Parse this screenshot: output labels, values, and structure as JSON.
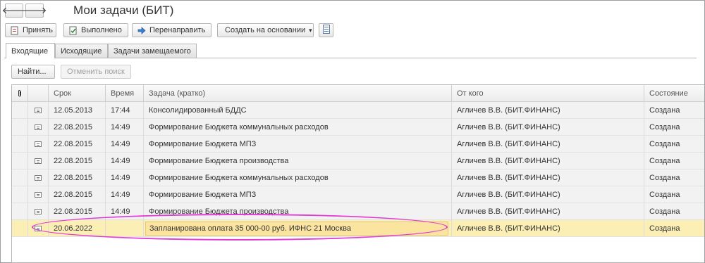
{
  "window": {
    "title": "Мои задачи (БИТ)"
  },
  "nav": {
    "back_label": "🡐",
    "forward_label": "🡒"
  },
  "toolbar": {
    "accept_label": "Принять",
    "done_label": "Выполнено",
    "redirect_label": "Перенаправить",
    "create_based_label": "Создать на основании",
    "dropdown_arrow": "▾"
  },
  "tabs": [
    {
      "label": "Входящие"
    },
    {
      "label": "Исходящие"
    },
    {
      "label": "Задачи замещаемого"
    }
  ],
  "search": {
    "find_label": "Найти...",
    "cancel_label": "Отменить поиск"
  },
  "table": {
    "columns": {
      "attach": "",
      "date": "Срок",
      "time": "Время",
      "task": "Задача (кратко)",
      "from": "От кого",
      "status": "Состояние"
    },
    "rows": [
      {
        "date": "12.05.2013",
        "time": "17:44",
        "task": "Консолидированный БДДС",
        "from": "Агличев В.В. (БИТ.ФИНАНС)",
        "status": "Создана"
      },
      {
        "date": "22.08.2015",
        "time": "14:49",
        "task": "Формирование Бюджета коммунальных расходов",
        "from": "Агличев В.В. (БИТ.ФИНАНС)",
        "status": "Создана"
      },
      {
        "date": "22.08.2015",
        "time": "14:49",
        "task": "Формирование Бюджета МПЗ",
        "from": "Агличев В.В. (БИТ.ФИНАНС)",
        "status": "Создана"
      },
      {
        "date": "22.08.2015",
        "time": "14:49",
        "task": "Формирование Бюджета производства",
        "from": "Агличев В.В. (БИТ.ФИНАНС)",
        "status": "Создана"
      },
      {
        "date": "22.08.2015",
        "time": "14:49",
        "task": "Формирование Бюджета коммунальных расходов",
        "from": "Агличев В.В. (БИТ.ФИНАНС)",
        "status": "Создана"
      },
      {
        "date": "22.08.2015",
        "time": "14:49",
        "task": "Формирование Бюджета МПЗ",
        "from": "Агличев В.В. (БИТ.ФИНАНС)",
        "status": "Создана"
      },
      {
        "date": "22.08.2015",
        "time": "14:49",
        "task": "Формирование Бюджета производства",
        "from": "Агличев В.В. (БИТ.ФИНАНС)",
        "status": "Создана"
      },
      {
        "date": "20.06.2022",
        "time": "",
        "task": "Запланирована оплата 35 000-00 руб. ИФНС 21 Москва",
        "from": "Агличев В.В. (БИТ.ФИНАНС)",
        "status": "Создана"
      }
    ]
  },
  "colors": {
    "selected_row": "#fbefb5",
    "selected_cell": "#fbe3a0",
    "highlight_ellipse": "#e23ad6"
  }
}
